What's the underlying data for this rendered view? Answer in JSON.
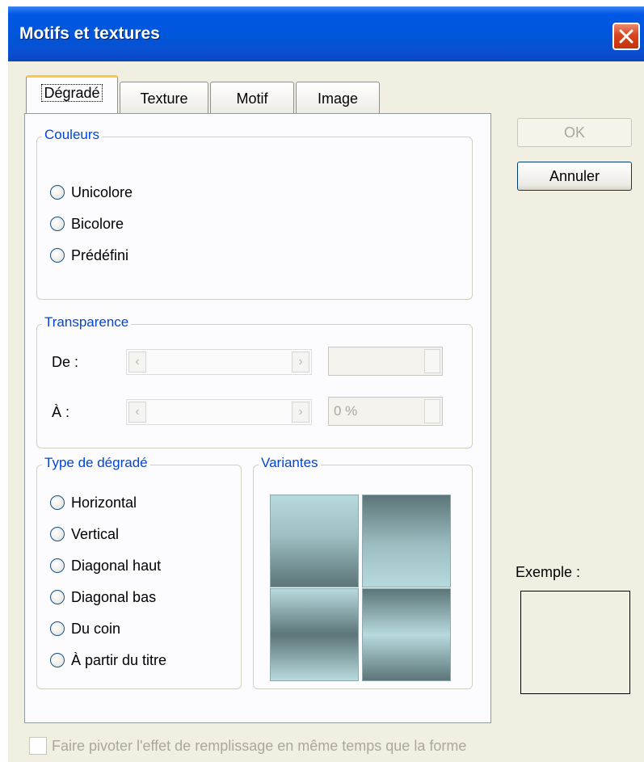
{
  "window": {
    "title": "Motifs et textures"
  },
  "tabs": [
    {
      "label": "Dégradé",
      "active": true
    },
    {
      "label": "Texture",
      "active": false
    },
    {
      "label": "Motif",
      "active": false
    },
    {
      "label": "Image",
      "active": false
    }
  ],
  "couleurs": {
    "legend": "Couleurs",
    "options": [
      "Unicolore",
      "Bicolore",
      "Prédéfini"
    ]
  },
  "transparence": {
    "legend": "Transparence",
    "de_label": "De :",
    "a_label": "À :",
    "de_value": "",
    "a_value": "0 %"
  },
  "type_degrade": {
    "legend": "Type de dégradé",
    "options": [
      "Horizontal",
      "Vertical",
      "Diagonal haut",
      "Diagonal bas",
      "Du coin",
      "À partir du titre"
    ]
  },
  "variantes": {
    "legend": "Variantes"
  },
  "buttons": {
    "ok": "OK",
    "annuler": "Annuler"
  },
  "exemple_label": "Exemple :",
  "checkbox_label": "Faire pivoter l'effet de remplissage en même temps que la forme",
  "colors": {
    "title_bar": "#0055d8",
    "legend_text": "#0046d5",
    "dialog_bg": "#f1efe2"
  },
  "icons": {
    "close": "close-icon",
    "slider_left": "chevron-left-icon",
    "slider_right": "chevron-right-icon",
    "spin": "spin-arrows-icon"
  }
}
